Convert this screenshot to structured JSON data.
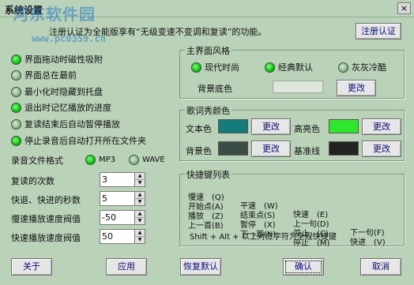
{
  "window": {
    "title": "系统设置",
    "close_label": "×",
    "watermark": "河东软件园",
    "watermark_url": "www.pc0359.cn"
  },
  "notice": {
    "text": "注册认证为全能版享有“无级变速不变调和复读”的功能。",
    "register_button": "注册认证"
  },
  "options": [
    {
      "label": "界面拖动时磁性吸附",
      "checked": true
    },
    {
      "label": "界面总在最前",
      "checked": false
    },
    {
      "label": "最小化时隐藏到托盘",
      "checked": false
    },
    {
      "label": "退出时记忆播放的进度",
      "checked": true
    },
    {
      "label": "复读结束后自动暂停播放",
      "checked": false
    },
    {
      "label": "停止录音后自动打开所在文件夹",
      "checked": true
    }
  ],
  "record_format": {
    "label": "录音文件格式",
    "choices": [
      {
        "label": "MP3",
        "checked": true
      },
      {
        "label": "WAVE",
        "checked": false
      }
    ]
  },
  "spinners": [
    {
      "label": "复读的次数",
      "value": "3"
    },
    {
      "label": "快退、快进的秒数",
      "value": "5"
    },
    {
      "label": "慢速播放速度阀值",
      "value": "-50"
    },
    {
      "label": "快速播放速度阀值",
      "value": "50"
    }
  ],
  "theme": {
    "title": "主界面风格",
    "choices": [
      {
        "label": "现代时尚",
        "checked": true
      },
      {
        "label": "经典默认",
        "checked": true
      },
      {
        "label": "灰灰冷酷",
        "checked": false
      }
    ],
    "bg_label": "背景底色",
    "change": "更改"
  },
  "lyrics": {
    "title": "歌词秀颜色",
    "text_color": {
      "label": "文本色",
      "color": "#147d7c"
    },
    "highlight_color": {
      "label": "高亮色",
      "color": "#2ee82e"
    },
    "bg_color": {
      "label": "背景色",
      "color": "#3a4c44"
    },
    "baseline_color": {
      "label": "基准线",
      "color": "#222222"
    },
    "change": "更改"
  },
  "shortcuts": {
    "title": "快捷键列表",
    "rows": [
      [
        "慢速　(Q)",
        "平速　(W)",
        "快速　(E)",
        ""
      ],
      [
        "开始点(A)",
        "结束点(S)",
        "上一句(D)",
        "下一句(F)"
      ],
      [
        "播放　(Z)",
        "暂停　(X)",
        "停止　(C)",
        "快进　(V)"
      ],
      [
        "上一首(B)",
        "下一首(N)",
        "停止　(M)",
        ""
      ]
    ],
    "footer": "Shift + Alt + 以上对应字符为全程快捷键"
  },
  "footer": {
    "about": "关于",
    "apply": "应用",
    "restore": "恢复默认",
    "ok": "确认",
    "cancel": "取消"
  }
}
